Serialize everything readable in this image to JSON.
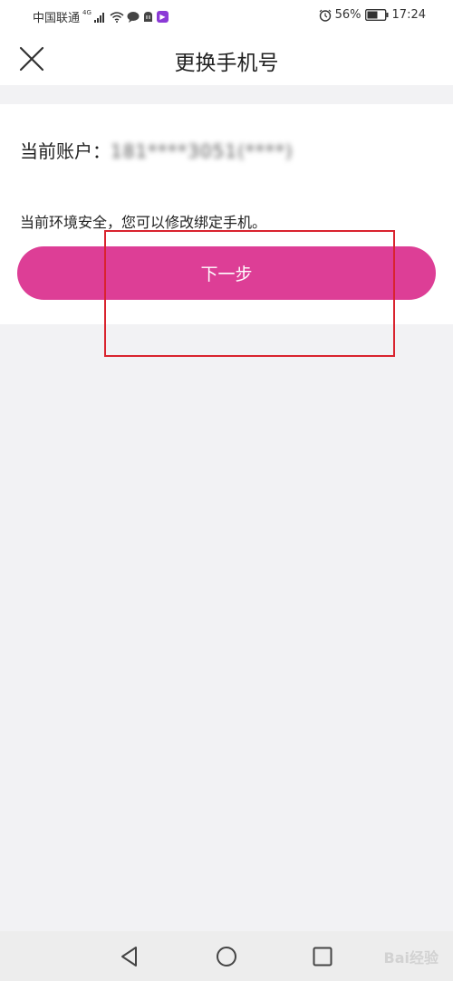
{
  "status_bar": {
    "carrier": "中国联通",
    "network_type": "4G",
    "battery_percent": "56%",
    "time": "17:24"
  },
  "header": {
    "title": "更换手机号"
  },
  "account": {
    "label": "当前账户：",
    "value": "181****3051(****)"
  },
  "message": "当前环境安全，您可以修改绑定手机。",
  "next_button": {
    "label": "下一步"
  },
  "watermark": "Bai经验",
  "colors": {
    "accent": "#dd3e96",
    "highlight": "#d9232e",
    "background": "#f2f2f4"
  }
}
